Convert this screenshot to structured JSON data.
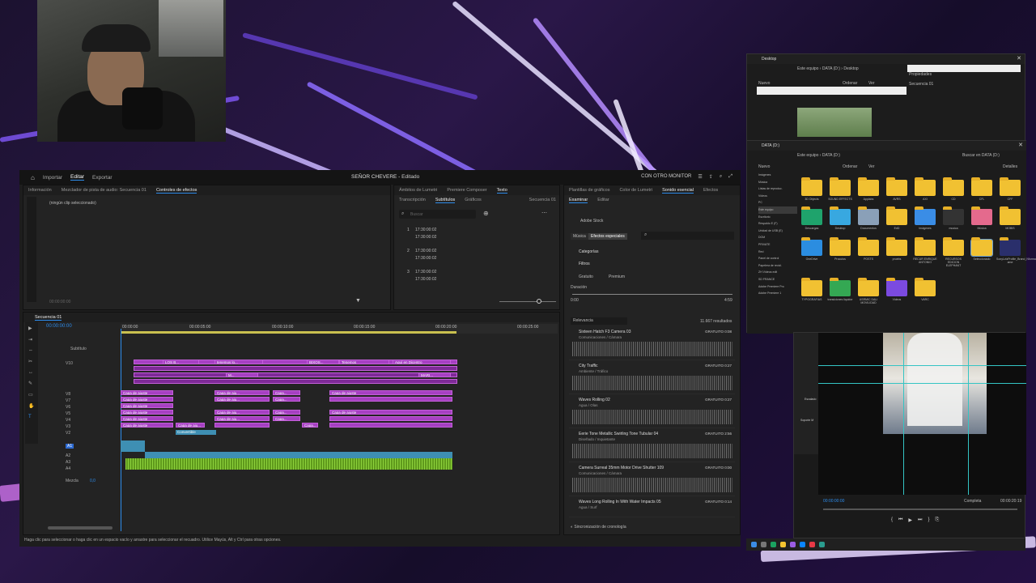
{
  "premiere": {
    "tabs": [
      "Importar",
      "Editar",
      "Exportar"
    ],
    "project_title": "SEÑOR CHEVERE",
    "project_status": "- Editado",
    "monitor_mode": "CON OTRO MONITOR",
    "source_tabs": [
      "Información",
      "Mezclador de pista de audio: Secuencia 01",
      "Controles de efectos"
    ],
    "no_clip": "(ningún clip seleccionado)",
    "zero_tc": "00:00:00:00",
    "text_tabs_top": [
      "Ámbitos de Lumetri",
      "Premiere Composer",
      "Texto"
    ],
    "text_tabs": [
      "Transcripción",
      "Subtítulos",
      "Gráficos"
    ],
    "sequence_label": "Secuencia 01",
    "search_placeholder": "Buscar",
    "captions": [
      {
        "num": "1",
        "tc1": "17:30:00:02",
        "tc2": "17:30:00:02"
      },
      {
        "num": "2",
        "tc1": "17:30:00:02",
        "tc2": "17:30:00:02"
      },
      {
        "num": "3",
        "tc1": "17:30:00:02",
        "tc2": "17:30:00:02"
      }
    ],
    "timeline": {
      "tab": "Secuencia 01",
      "timecode": "00:00:00:00",
      "ruler": [
        "00:00:00",
        "00:00:05:00",
        "00:00:10:00",
        "00:00:15:00",
        "00:00:20:00",
        "00:00:25:00"
      ],
      "subtitle_track": "Subtítulo",
      "video_tracks": [
        "V10",
        "V9",
        "V8",
        "V7",
        "V6",
        "V5",
        "V4",
        "V3",
        "V2",
        "V1"
      ],
      "audio_tracks": [
        "A1",
        "A2",
        "A3",
        "A4"
      ],
      "mix_label": "Mezcla",
      "mix_value": "0,0",
      "clip_labels_top": [
        "LOS B...",
        "tenemos lo...",
        "BIXOS...",
        "Tenemos",
        "Aquí en Dicentro"
      ],
      "clip_labels_mid": [
        "M...",
        "MARI..."
      ],
      "adjust": "Capa de ajuste",
      "adjust_short": "Capa de aju...",
      "adjust_shorter": "Capa...",
      "collapse": "Convertible"
    },
    "right_tabs": [
      "Plantillas de gráficos",
      "Color de Lumetri",
      "Sonido esencial",
      "Efectos"
    ],
    "browse_tabs": [
      "Examinar",
      "Editar"
    ],
    "adobe_stock": "Adobe Stock",
    "music_tab": "Música",
    "sfx_tab": "Efectos especiales",
    "categories": "Categorías",
    "filters": "Filtros",
    "free": "Gratuito",
    "premium": "Premium",
    "duration": "Duración",
    "dur_min": "0:00",
    "dur_max": "4:59",
    "relevance": "Relevancia",
    "results": "11.667 resultados",
    "sounds": [
      {
        "name": "Sixteen Hatch F3 Camera 03",
        "cat": "Comunicaciones / Cámara",
        "price": "GRATUITO",
        "dur": "0:08"
      },
      {
        "name": "City Traffic",
        "cat": "Ambiente / Tráfico",
        "price": "GRATUITO",
        "dur": "0:27"
      },
      {
        "name": "Waves Rolling 02",
        "cat": "Agua / Olas",
        "price": "GRATUITO",
        "dur": "0:27"
      },
      {
        "name": "Eerie Tone Metallic Swirling Tone Tubular 04",
        "cat": "Diseñado / Inquietante",
        "price": "GRATUITO",
        "dur": "2:56"
      },
      {
        "name": "Camera Surreal 35mm Motor Drive Shutter 109",
        "cat": "Comunicaciones / Cámara",
        "price": "GRATUITO",
        "dur": "0:00"
      },
      {
        "name": "Waves Long Rolling In With Water Impacts 05",
        "cat": "Agua / Surf",
        "price": "GRATUITO",
        "dur": "0:14"
      }
    ],
    "sync": "Sincronización de cronología",
    "status_text": "Haga clic para seleccionar o haga clic en un espacio vacío y arrastre para seleccionar el recuadro. Utilice Mayús, Alt y Ctrl para otras opciones."
  },
  "explorer": {
    "title1": "Desktop",
    "title2": "DATA (D:)",
    "path1": [
      "Este equipo",
      "DATA (D:)",
      "Desktop"
    ],
    "path2": [
      "Este equipo",
      "DATA (D:)"
    ],
    "search2": "Buscar en DATA (D:)",
    "new_label": "Nuevo",
    "sort_label": "Ordenar",
    "view_label": "Ver",
    "details": "Detalles",
    "props": "Propiedades",
    "seq_item": "Secuencia 01",
    "side_items": [
      "Imágenes",
      "Música",
      "Listas de reproduc.",
      "Vídeos",
      "PC",
      "Este equipo",
      "Escritorio",
      "Respaldo E (F)",
      "Unidad de USB (E)",
      "DOM",
      "PRIVATE",
      "Red",
      "Panel de control",
      "Papelera de recicl.",
      "ZH Vídeos edit",
      "SD FRANCE",
      "Adobe Premiere Pro",
      "Adobe Premiere 1"
    ],
    "folders": [
      "3D Objects",
      "SOUND EFFECTS",
      "Applabs",
      "AVRS",
      "AXI",
      "CD",
      "CFL",
      "CFF",
      "Descargas",
      "Desktop",
      "Documentos",
      "EdD",
      "Imágenes",
      "musica",
      "Música",
      "MOBIS",
      "OneDrive",
      "Procutos",
      "POSTS",
      "pruebs",
      "RECUR ENRIQUE ANTONIO",
      "RECURSOS EDICION ELEPHANT",
      "Seleccionado",
      "SonyLvlzProfile_Brand_NformatC ame",
      "TYPOGRAFIAS",
      "transiciones liquidor",
      "USRMIC DALI MOVILIDAD",
      "Videos",
      "VARC"
    ]
  },
  "preview": {
    "tc_left": "00:00:00:00",
    "zoom": "Completa",
    "tc_right": "00:00:20:19",
    "side_labels": [
      "Escalado",
      "Soporte M"
    ]
  }
}
